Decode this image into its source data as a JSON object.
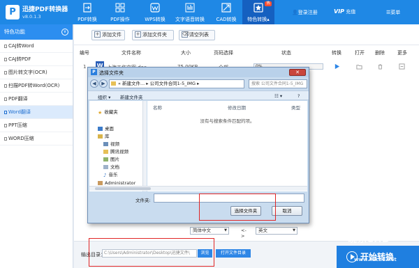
{
  "app": {
    "name": "迅捷PDF转换器",
    "version": "v8.0.1.3",
    "logo_letter": "P"
  },
  "nav": {
    "tabs": [
      {
        "label": "PDF转换",
        "icon": "convert-icon"
      },
      {
        "label": "PDF操作",
        "icon": "grid-icon"
      },
      {
        "label": "WPS转换",
        "icon": "wps-icon"
      },
      {
        "label": "文字语音转换",
        "icon": "audio-bars-icon"
      },
      {
        "label": "CAD转换",
        "icon": "cad-icon"
      },
      {
        "label": "特色转换",
        "icon": "feature-icon"
      }
    ],
    "hot_badge": "热",
    "login": "登录注册",
    "vip": "VIP",
    "recharge": "充值",
    "menu": "菜单"
  },
  "sidebar": {
    "header": "特色功能",
    "items": [
      "CAJ转Word",
      "CAJ转PDF",
      "图片转文字(OCR)",
      "扫描PDF转Word(OCR)",
      "PDF翻译",
      "Word翻译",
      "PPT压缩",
      "WORD压缩"
    ]
  },
  "toolbar": {
    "add_file": "添加文件",
    "add_folder": "添加文件夹",
    "clear_list": "清空列表"
  },
  "table": {
    "headers": [
      "编号",
      "文件名称",
      "大小",
      "页码选择",
      "状态",
      "转换",
      "打开",
      "删除",
      "更多"
    ],
    "row": {
      "num": "1",
      "name": "上海工作文案.doc",
      "size": "75.00KB",
      "pages": "全部",
      "progress": "0%"
    }
  },
  "language": {
    "from": "简体中文",
    "arrow": "<->",
    "to": "英文"
  },
  "output": {
    "label": "输出目录：",
    "path": "C:\\Users\\Administrator\\Desktop\\迅捷文件\\",
    "browse": "浏览",
    "open_dir": "打开文件目录",
    "start": "开始转换"
  },
  "dialog": {
    "title": "选择文件夹",
    "address": "« 新建文件... ▸ 公司文件合同1-5_IMG ▸",
    "search_placeholder": "搜索 公司文件合同1-5_IMG",
    "organize": "组织 ▾",
    "new_folder": "新建文件夹",
    "tree": [
      "收藏夹",
      "桌面",
      "库",
      "视频",
      "腾讯视频",
      "图片",
      "文档",
      "音乐",
      "Administrator"
    ],
    "col_name": "名称",
    "col_date": "修改日期",
    "col_type": "类型",
    "empty_text": "没有与搜索条件匹配的项。",
    "folder_label": "文件夹:",
    "select_btn": "选择文件夹",
    "cancel_btn": "取消"
  },
  "watermark": {
    "line1": "晓东CAD",
    "line2": "www.xdcad.net"
  }
}
